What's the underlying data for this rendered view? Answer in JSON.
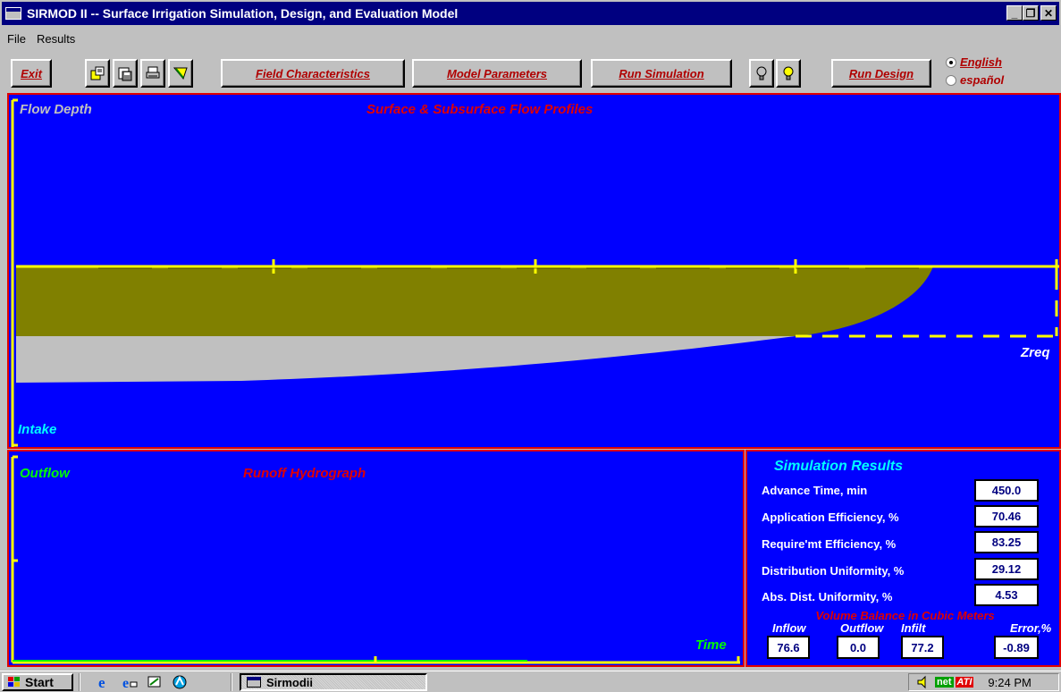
{
  "window": {
    "title": "SIRMOD II -- Surface Irrigation Simulation, Design, and Evaluation Model",
    "minimize": "_",
    "maximize": "❐",
    "close": "✕"
  },
  "menu": {
    "file": "File",
    "results": "Results"
  },
  "toolbar": {
    "exit": "Exit",
    "field_characteristics": "Field Characteristics",
    "model_parameters": "Model Parameters",
    "run_simulation": "Run Simulation",
    "run_design": "Run Design",
    "lang_english": "English",
    "lang_spanish": "español",
    "selected_language": "English"
  },
  "profile_panel": {
    "y_top_label": "Flow Depth",
    "title": "Surface & Subsurface Flow Profiles",
    "y_bottom_label": "Intake",
    "zreq_label": "Zreq"
  },
  "hydrograph_panel": {
    "y_label": "Outflow",
    "title": "Runoff Hydrograph",
    "x_label": "Time"
  },
  "results": {
    "title": "Simulation Results",
    "rows": [
      {
        "label": "Advance Time, min",
        "value": "450.0"
      },
      {
        "label": "Application Efficiency, %",
        "value": "70.46"
      },
      {
        "label": "Require'mt Efficiency, %",
        "value": "83.25"
      },
      {
        "label": "Distribution Uniformity, %",
        "value": "29.12"
      },
      {
        "label": "Abs. Dist. Uniformity, %",
        "value": "4.53"
      }
    ],
    "volume_balance_title": "Volume Balance in Cubic Meters",
    "inflow_label": "Inflow",
    "inflow_value": "76.6",
    "outflow_label": "Outflow",
    "outflow_value": "0.0",
    "infilt_label": "Infilt",
    "infilt_value": "77.2",
    "error_label": "Error,%",
    "error_value": "-0.89"
  },
  "taskbar": {
    "start": "Start",
    "task": "Sirmodii",
    "clock": "9:24 PM",
    "tray_badge": "net",
    "tray_badge2": "ATI"
  },
  "colors": {
    "plot_bg": "#0000ff",
    "surface_flow": "#808000",
    "subsurface": "#c0c0c0",
    "axis": "#ffff00",
    "panel_border": "#e00000",
    "title_red": "#e00000",
    "label_cyan": "#00ffff",
    "label_green": "#00ff00"
  }
}
